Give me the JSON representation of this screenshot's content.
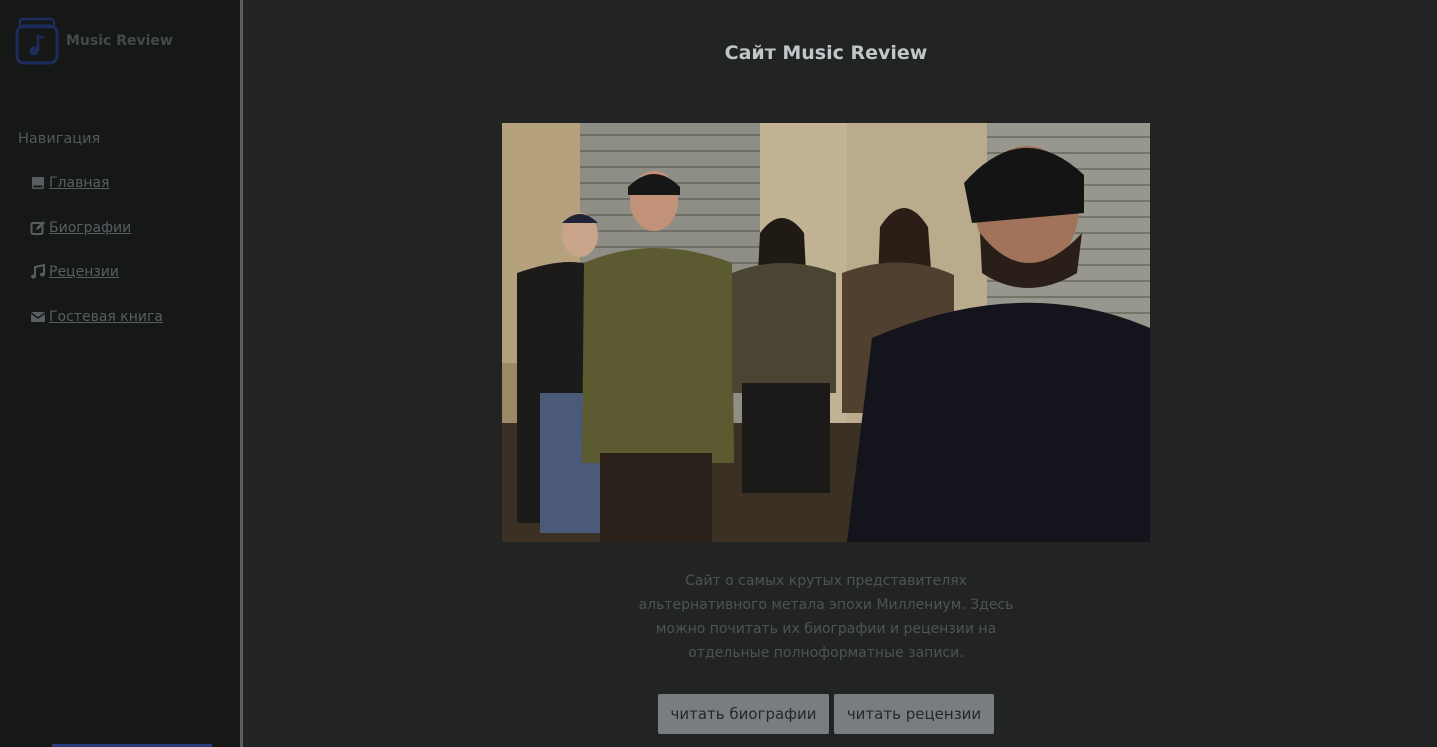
{
  "brand": {
    "name": "Music Review",
    "icon": "music-box-logo"
  },
  "nav": {
    "heading": "Навигация",
    "items": [
      {
        "label": "Главная",
        "icon": "book-icon"
      },
      {
        "label": "Биографии",
        "icon": "edit-icon"
      },
      {
        "label": "Рецензии",
        "icon": "music-note-icon"
      },
      {
        "label": "Гостевая книга",
        "icon": "envelope-icon"
      }
    ]
  },
  "main": {
    "title": "Сайт Music Review",
    "description": "Сайт о самых крутых представителях альтернативного метала эпохи Миллениум. Здесь можно почитать их биографии и рецензии на отдельные полноформатные записи.",
    "buttons": {
      "bios": "читать биографии",
      "reviews": "читать рецензии"
    }
  },
  "colors": {
    "background": "#222424",
    "sidebar": "#161818",
    "button": "#7a7d7f"
  }
}
